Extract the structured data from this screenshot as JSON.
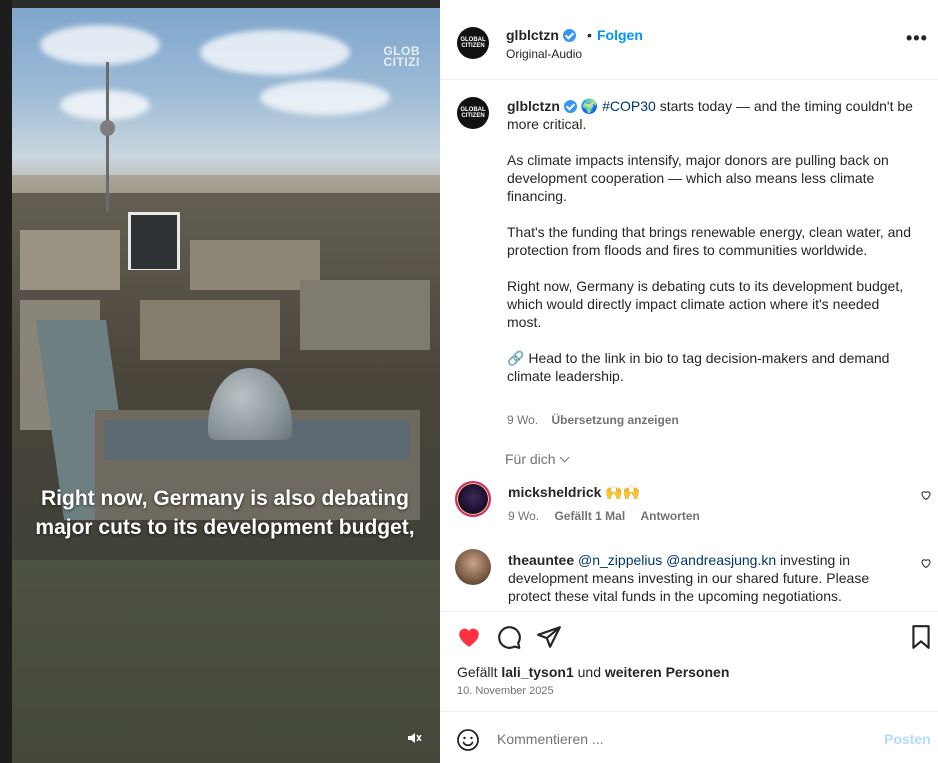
{
  "media": {
    "watermark_line1": "GLOB",
    "watermark_line2": "CITIZI",
    "caption": "Right now, Germany is also debating major cuts to its development budget,",
    "mute_icon": "speaker-muted-icon"
  },
  "header": {
    "avatar_text": "GLOBAL CITIZEN",
    "username": "glblctzn",
    "separator": "•",
    "follow_label": "Folgen",
    "audio_label": "Original-Audio",
    "more_label": "•••"
  },
  "post": {
    "username": "glblctzn",
    "hashtag": "#COP30",
    "line1_rest": " starts today — and the timing couldn't be more critical.",
    "para2": "As climate impacts intensify, major donors are pulling back on development cooperation — which also means less climate financing.",
    "para3": "That's the funding that brings renewable energy, clean water, and protection from floods and fires to communities worldwide.",
    "para4": "Right now, Germany is debating cuts to its development budget, which would directly impact climate action where it's needed most.",
    "para5_icon": "🔗",
    "para5": " Head to the link in bio to tag decision-makers and demand climate leadership.",
    "age": "9 Wo.",
    "translate_label": "Übersetzung anzeigen",
    "for_you_label": "Für dich"
  },
  "comments": [
    {
      "username": "micksheldrick",
      "text": "🙌🙌",
      "age": "9 Wo.",
      "likes": "Gefällt 1 Mal",
      "reply_label": "Antworten"
    },
    {
      "username": "theauntee",
      "mention1": "@n_zippelius",
      "mention2": "@andreasjung.kn",
      "text": " investing in development means investing in our shared future. Please protect these vital funds in the upcoming negotiations."
    }
  ],
  "actions": {
    "likes_prefix": "Gefällt ",
    "likes_user": "lali_tyson1",
    "likes_mid": " und ",
    "likes_rest": "weiteren Personen",
    "date": "10. November 2025"
  },
  "composer": {
    "placeholder": "Kommentieren ...",
    "post_label": "Posten"
  },
  "colors": {
    "accent": "#0095f6",
    "like_red": "#ff3040",
    "mention": "#00376b",
    "muted_text": "#737373"
  }
}
